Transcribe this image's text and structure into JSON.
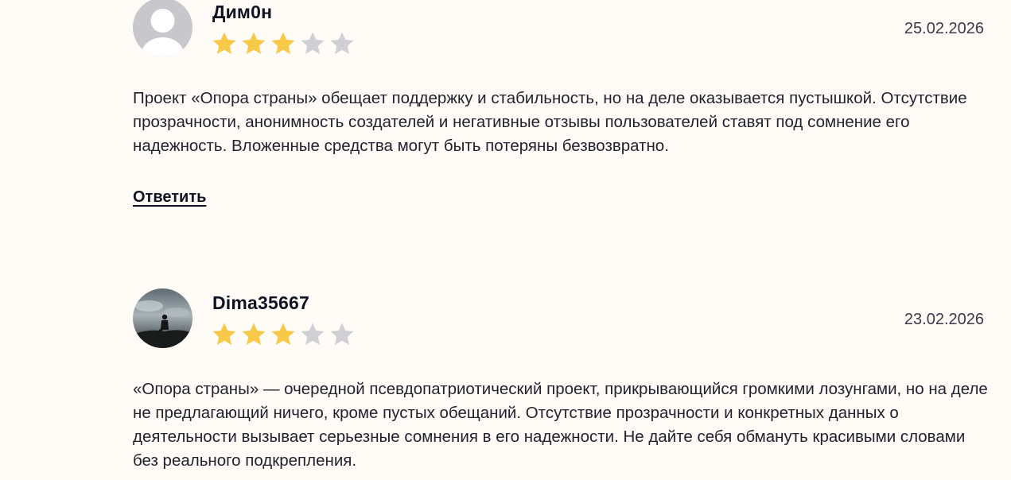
{
  "reviews": [
    {
      "author": "Дим0н",
      "avatar": "default-avatar-icon",
      "rating": 3,
      "max_rating": 5,
      "date": "25.02.2026",
      "text": "Проект «Опора страны» обещает поддержку и стабильность, но на деле оказывается пустышкой. Отсутствие прозрачности, анонимность создателей и негативные отзывы пользователей ставят под сомнение его надежность. Вложенные средства могут быть потеряны безвозвратно.",
      "reply_label": "Ответить"
    },
    {
      "author": "Dima35667",
      "avatar": "photo-avatar",
      "rating": 3,
      "max_rating": 5,
      "date": "23.02.2026",
      "text": "«Опора страны» — очередной псевдопатриотический проект, прикрывающийся громкими лозунгами, но на деле не предлагающий ничего, кроме пустых обещаний. Отсутствие прозрачности и конкретных данных о деятельности вызывает серьезные сомнения в его надежности. Не дайте себя обмануть красивыми словами без реального подкрепления."
    }
  ],
  "colors": {
    "background": "#fffbf7",
    "star_filled": "#f8c948",
    "star_empty": "#cfcfd4",
    "text": "#22222e"
  }
}
